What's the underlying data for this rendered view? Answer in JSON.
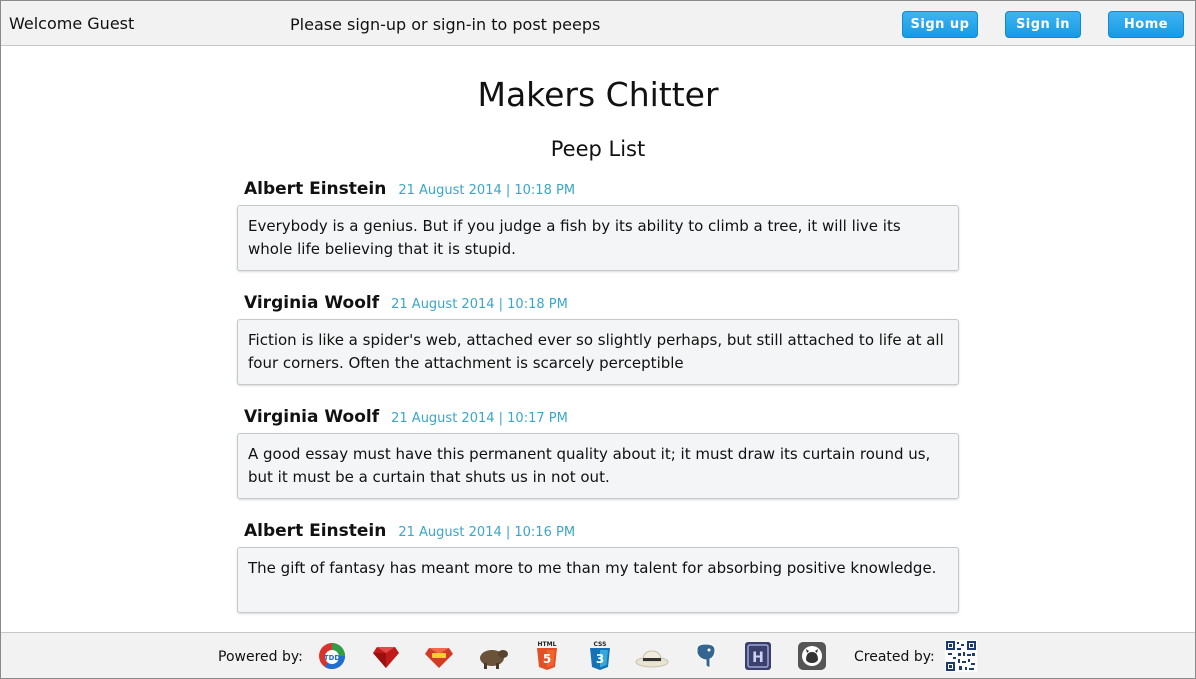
{
  "header": {
    "welcome": "Welcome Guest",
    "notice": "Please sign-up or sign-in to post peeps",
    "buttons": {
      "signup": "Sign up",
      "signin": "Sign in",
      "home": "Home"
    }
  },
  "page": {
    "title": "Makers Chitter",
    "subtitle": "Peep List"
  },
  "peeps": [
    {
      "author": "Albert Einstein",
      "time": "21 August 2014 | 10:18 PM",
      "text": "Everybody is a genius. But if you judge a fish by its ability to climb a tree, it will live its whole life believing that it is stupid."
    },
    {
      "author": "Virginia Woolf",
      "time": "21 August 2014 | 10:18 PM",
      "text": "Fiction is like a spider's web, attached ever so slightly perhaps, but still attached to life at all four corners. Often the attachment is scarcely perceptible"
    },
    {
      "author": "Virginia Woolf",
      "time": "21 August 2014 | 10:17 PM",
      "text": "A good essay must have this permanent quality about it; it must draw its curtain round us, but it must be a curtain that shuts us in not out."
    },
    {
      "author": "Albert Einstein",
      "time": "21 August 2014 | 10:16 PM",
      "text": "The gift of fantasy has meant more to me than my talent for absorbing positive knowledge."
    }
  ],
  "footer": {
    "powered_label": "Powered by:",
    "created_label": "Created by:",
    "icons": [
      "tdd-icon",
      "ruby-icon",
      "rspec-icon",
      "capybara-icon",
      "html5-icon",
      "css3-icon",
      "sinatra-hat-icon",
      "postgresql-elephant-icon",
      "heroku-icon",
      "github-icon",
      "qr-code-icon"
    ],
    "html5_text": "HTML",
    "css3_text": "CSS",
    "heroku_text": "H",
    "tdd_text": "TDD"
  }
}
